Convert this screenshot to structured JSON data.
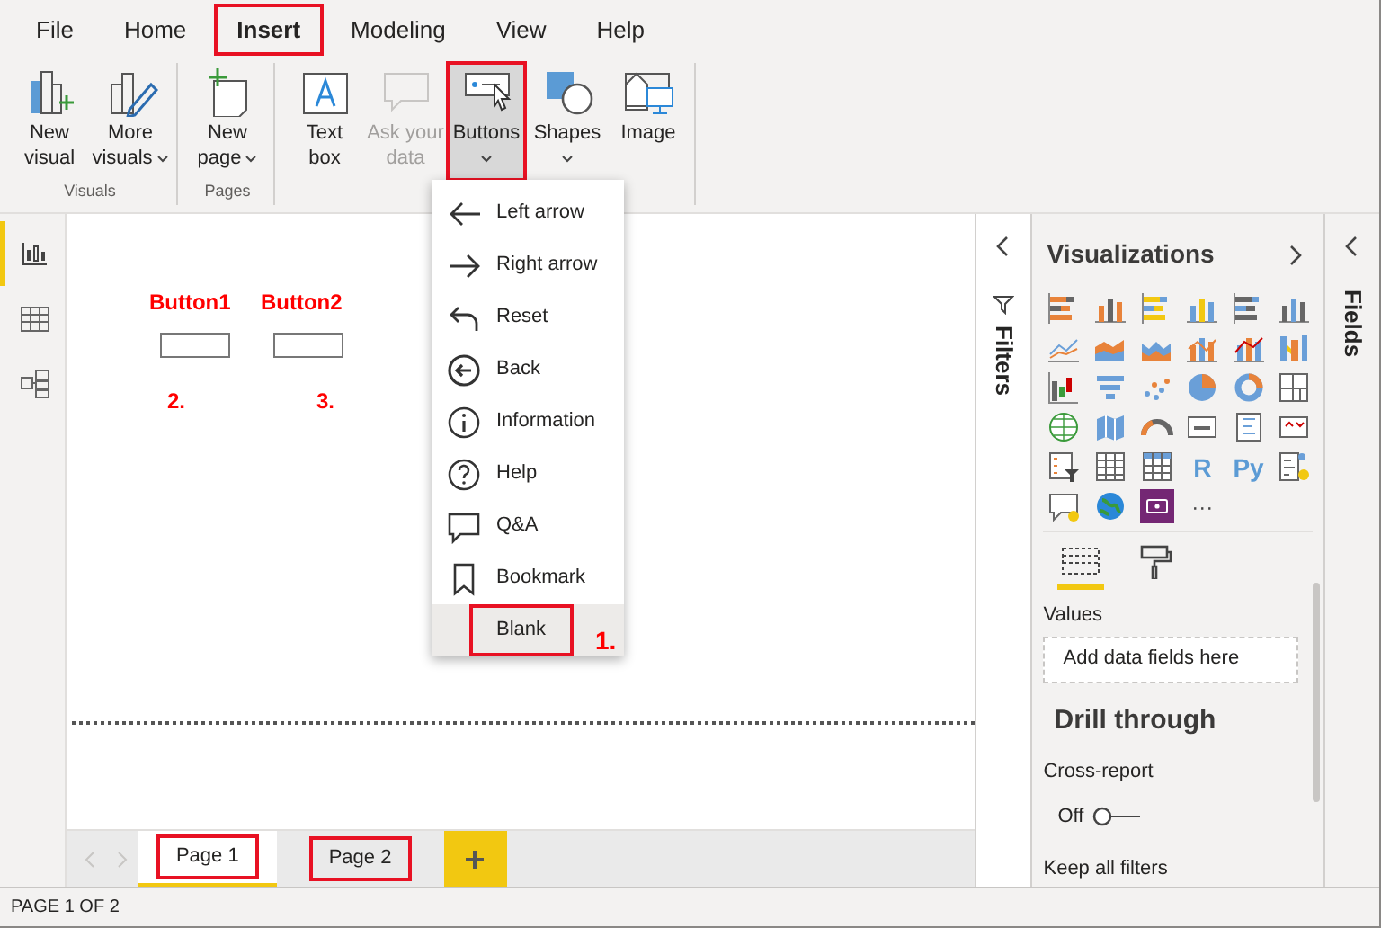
{
  "menu_tabs": [
    {
      "label": "File",
      "selected": false,
      "annotated": false
    },
    {
      "label": "Home",
      "selected": false,
      "annotated": false
    },
    {
      "label": "Insert",
      "selected": true,
      "annotated": true
    },
    {
      "label": "Modeling",
      "selected": false,
      "annotated": false
    },
    {
      "label": "View",
      "selected": false,
      "annotated": false
    },
    {
      "label": "Help",
      "selected": false,
      "annotated": false
    }
  ],
  "ribbon": {
    "groups": [
      {
        "label": "Visuals",
        "buttons": [
          {
            "lines": [
              "New",
              "visual"
            ],
            "dropdown": false,
            "disabled": false,
            "pressed": false,
            "annotated": false
          },
          {
            "lines": [
              "More",
              "visuals"
            ],
            "dropdown": true,
            "disabled": false,
            "pressed": false,
            "annotated": false
          }
        ]
      },
      {
        "label": "Pages",
        "buttons": [
          {
            "lines": [
              "New",
              "page"
            ],
            "dropdown": true,
            "disabled": false,
            "pressed": false,
            "annotated": false
          }
        ]
      },
      {
        "buttons": [
          {
            "lines": [
              "Text",
              "box"
            ],
            "dropdown": false,
            "disabled": false,
            "pressed": false,
            "annotated": false
          },
          {
            "lines": [
              "Ask your",
              "data"
            ],
            "dropdown": false,
            "disabled": true,
            "pressed": false,
            "annotated": false
          },
          {
            "lines": [
              "Buttons"
            ],
            "dropdown": true,
            "disabled": false,
            "pressed": true,
            "annotated": true
          },
          {
            "lines": [
              "Shapes"
            ],
            "dropdown": true,
            "disabled": false,
            "pressed": false,
            "annotated": false
          },
          {
            "lines": [
              "Image"
            ],
            "dropdown": false,
            "disabled": false,
            "pressed": false,
            "annotated": false
          }
        ]
      }
    ]
  },
  "buttons_menu": {
    "items": [
      {
        "label": "Left arrow",
        "hovered": false,
        "annotated": false
      },
      {
        "label": "Right arrow",
        "hovered": false,
        "annotated": false
      },
      {
        "label": "Reset",
        "hovered": false,
        "annotated": false
      },
      {
        "label": "Back",
        "hovered": false,
        "annotated": false
      },
      {
        "label": "Information",
        "hovered": false,
        "annotated": false
      },
      {
        "label": "Help",
        "hovered": false,
        "annotated": false
      },
      {
        "label": "Q&A",
        "hovered": false,
        "annotated": false
      },
      {
        "label": "Bookmark",
        "hovered": false,
        "annotated": false
      },
      {
        "label": "Blank",
        "hovered": true,
        "annotated": true
      }
    ],
    "step_label": "1."
  },
  "left_rail": {
    "views": [
      {
        "selected": true
      },
      {
        "selected": false
      },
      {
        "selected": false
      }
    ]
  },
  "canvas": {
    "buttons": [
      {
        "title": "Button1",
        "step": "2."
      },
      {
        "title": "Button2",
        "step": "3."
      }
    ]
  },
  "page_tabs": {
    "pages": [
      {
        "label": "Page 1",
        "selected": true,
        "annotated": true
      },
      {
        "label": "Page 2",
        "selected": false,
        "annotated": true
      }
    ]
  },
  "filters_pane": {
    "title": "Filters"
  },
  "visualizations_pane": {
    "title": "Visualizations",
    "script_visuals": [
      "R",
      "Py"
    ],
    "more": "···",
    "field_tabs": [
      {
        "selected": true
      },
      {
        "selected": false
      }
    ],
    "well_label": "Values",
    "well_placeholder": "Add data fields here",
    "drill_through": {
      "title": "Drill through",
      "cross_report_label": "Cross-report",
      "toggle": {
        "label": "Off",
        "on": false
      },
      "keep_filters_label": "Keep all filters"
    }
  },
  "fields_pane": {
    "title": "Fields"
  },
  "status_bar": {
    "text": "PAGE 1 OF 2"
  }
}
